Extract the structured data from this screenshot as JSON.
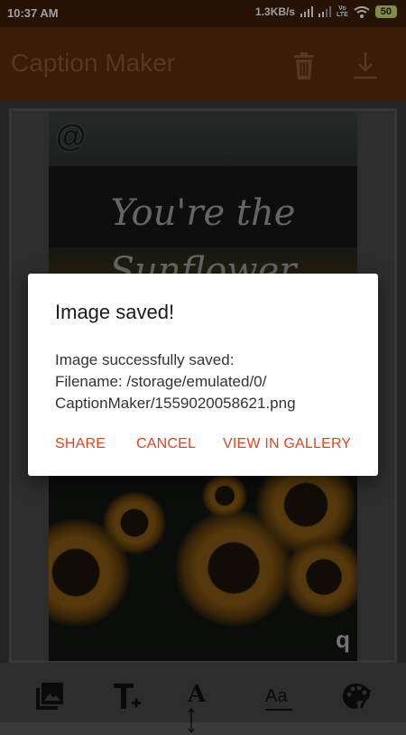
{
  "status_bar": {
    "time": "10:37 AM",
    "net_speed": "1.3KB/s",
    "volte_top": "Vo",
    "volte_bottom": "LTE",
    "battery": "50"
  },
  "app_bar": {
    "title": "Caption Maker",
    "icons": [
      "trash-icon",
      "download-icon"
    ]
  },
  "canvas": {
    "caption_line1": "You're the",
    "caption_line2": "Sunflower",
    "corner_top": "@",
    "corner_bottom": "q"
  },
  "dialog": {
    "title": "Image saved!",
    "message": "Image successfully saved:\n  Filename: /storage/emulated/0/\nCaptionMaker/1559020058621.png",
    "share_label": "SHARE",
    "cancel_label": "CANCEL",
    "gallery_label": "VIEW IN GALLERY"
  },
  "toolbar": {
    "icons": [
      "gallery-icon",
      "text-add-icon",
      "text-size-icon",
      "font-icon",
      "palette-icon"
    ],
    "text_size_label": "A",
    "font_label": "Aa"
  },
  "colors": {
    "app_bar": "#5e2e0d",
    "accent": "#e0451d"
  }
}
